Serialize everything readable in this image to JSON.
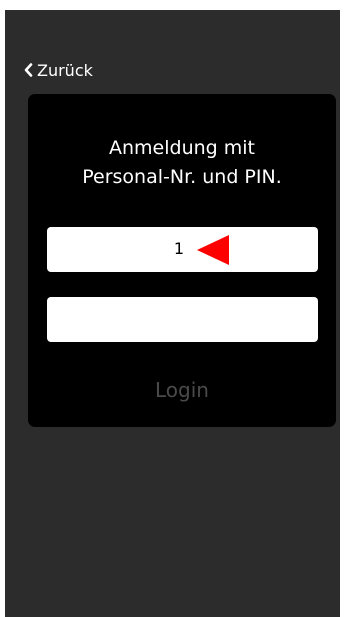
{
  "nav": {
    "back_label": "Zurück"
  },
  "login_form": {
    "title": "Anmeldung mit\nPersonal-Nr. und PIN.",
    "personal_nr_value": "1",
    "pin_value": "",
    "login_label": "Login"
  },
  "icons": {
    "back": "chevron-left-icon",
    "pointer": "red-arrow-icon"
  },
  "colors": {
    "screen_bg": "#2c2c2c",
    "card_bg": "#000000",
    "field_bg": "#ffffff",
    "login_disabled": "#4a4a4a",
    "arrow": "#ff0000"
  }
}
